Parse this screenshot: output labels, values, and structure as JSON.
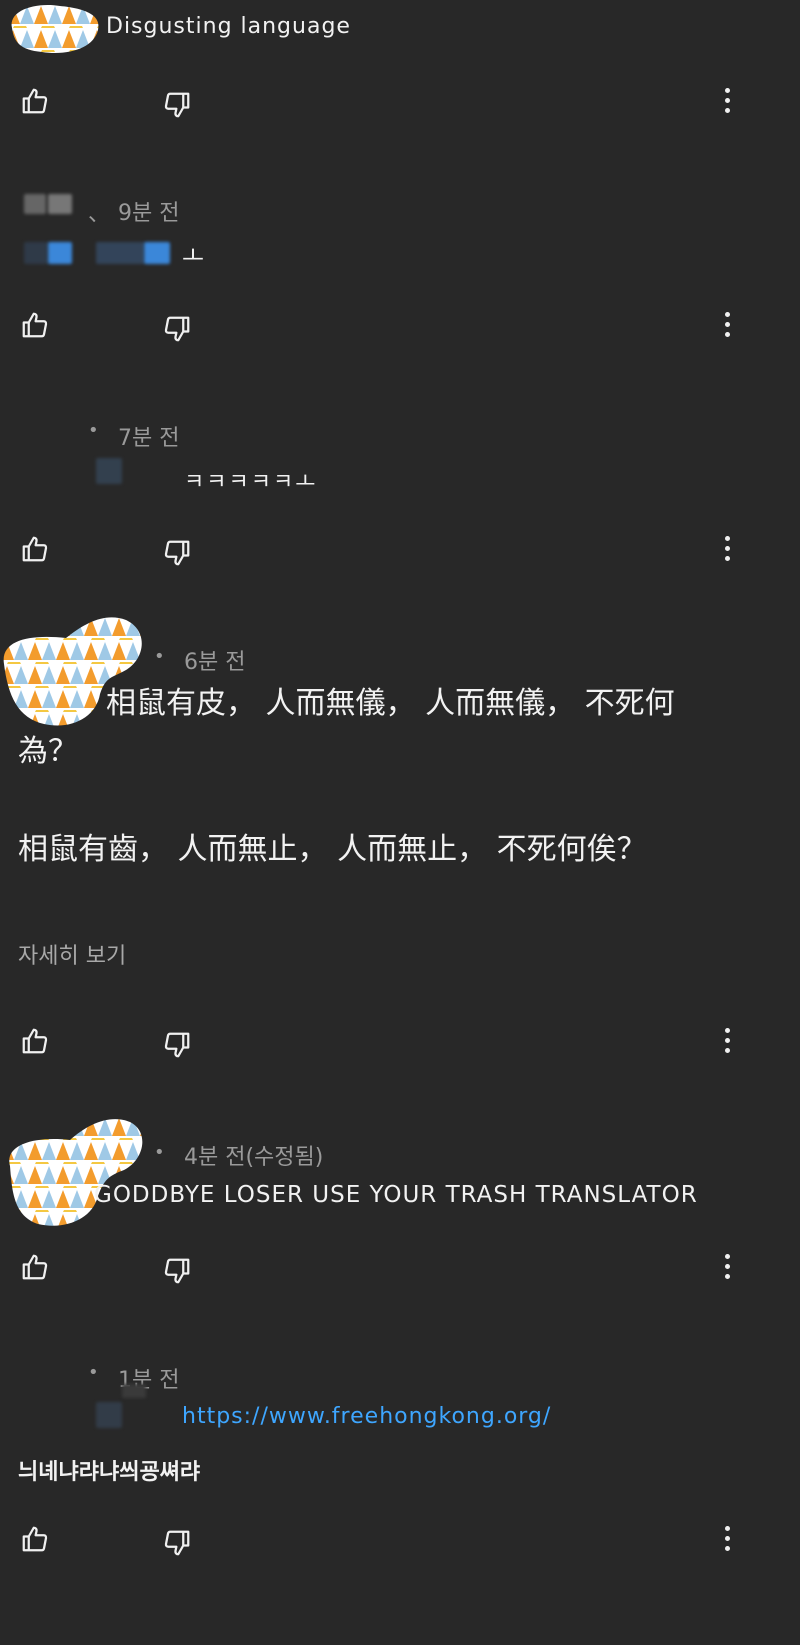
{
  "comments": [
    {
      "id": "c1",
      "text": "Disgusting language"
    },
    {
      "id": "c2",
      "time": "9분 전",
      "text": "ㅗ"
    },
    {
      "id": "c3",
      "time": "7분 전",
      "text": "ㅋㅋㅋㅋㅋㅗ"
    },
    {
      "id": "c4",
      "time": "6분 전",
      "line1": "相鼠有皮， 人而無儀， 人而無儀， 不死何",
      "line1b": "為？",
      "line2": "相鼠有齒， 人而無止， 人而無止， 不死何俟？",
      "more_label": "자세히 보기"
    },
    {
      "id": "c5",
      "time": "4분 전(수정됨)",
      "text": "GODDBYE LOSER USE YOUR TRASH TRANSLATOR"
    },
    {
      "id": "c6",
      "time": "1분 전",
      "link": "https://www.freehongkong.org/",
      "text": "늬녜냐랴냐씌굥쎠랴"
    }
  ],
  "icons": {
    "like": "thumbs-up-icon",
    "dislike": "thumbs-down-icon",
    "more": "more-vert-icon"
  },
  "colors": {
    "background": "#282828",
    "link": "#3ea6ff",
    "meta": "#9a9a9a"
  }
}
